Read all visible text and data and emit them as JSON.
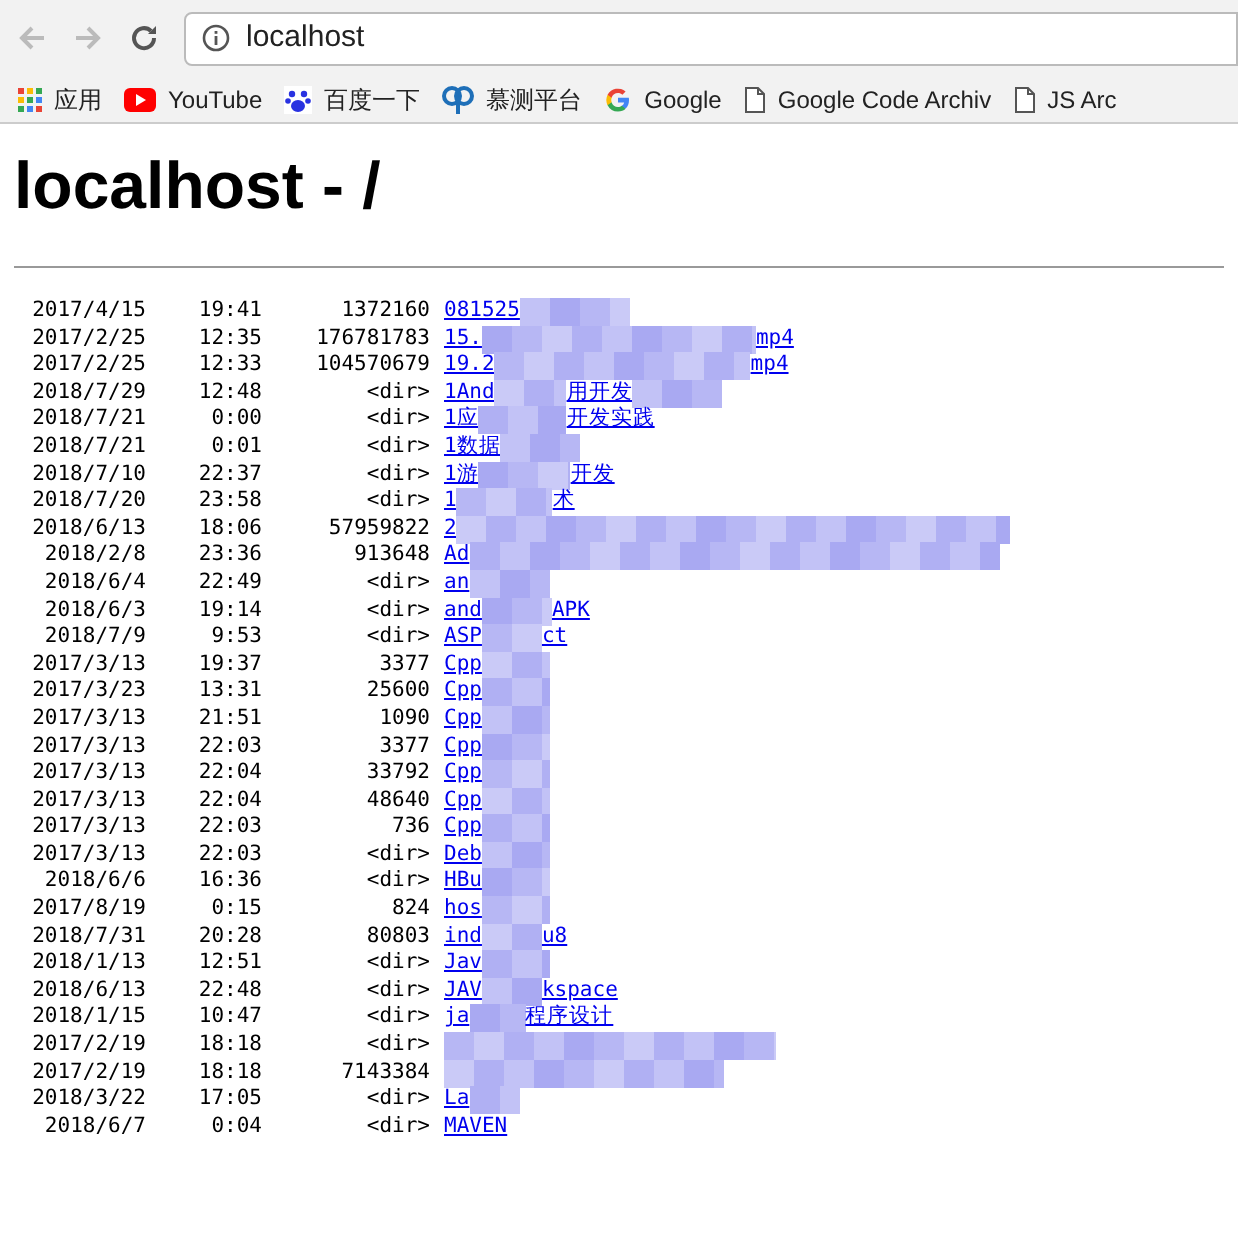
{
  "browser": {
    "address": "localhost",
    "bookmarks": [
      {
        "kind": "apps",
        "label": "应用"
      },
      {
        "kind": "youtube",
        "label": "YouTube"
      },
      {
        "kind": "baidu",
        "label": "百度一下"
      },
      {
        "kind": "muce",
        "label": "慕测平台"
      },
      {
        "kind": "google",
        "label": "Google"
      },
      {
        "kind": "page",
        "label": "Google Code Archiv"
      },
      {
        "kind": "page",
        "label": "JS Arc"
      }
    ]
  },
  "heading": "localhost - /",
  "listing": [
    {
      "date": "2017/4/15",
      "time": "19:41",
      "size": "1372160",
      "link": [
        "081525"
      ]
    },
    {
      "date": "2017/2/25",
      "time": "12:35",
      "size": "176781783",
      "link": [
        "15.",
        "mp4"
      ]
    },
    {
      "date": "2017/2/25",
      "time": "12:33",
      "size": "104570679",
      "link": [
        "19.2",
        "mp4"
      ]
    },
    {
      "date": "2018/7/29",
      "time": "12:48",
      "size": "<dir>",
      "link": [
        "1And",
        "用开发"
      ]
    },
    {
      "date": "2018/7/21",
      "time": "0:00",
      "size": "<dir>",
      "link": [
        "1应",
        "开发实践"
      ]
    },
    {
      "date": "2018/7/21",
      "time": "0:01",
      "size": "<dir>",
      "link": [
        "1数据"
      ]
    },
    {
      "date": "2018/7/10",
      "time": "22:37",
      "size": "<dir>",
      "link": [
        "1游",
        "开发"
      ]
    },
    {
      "date": "2018/7/20",
      "time": "23:58",
      "size": "<dir>",
      "link": [
        "1",
        "术"
      ]
    },
    {
      "date": "2018/6/13",
      "time": "18:06",
      "size": "57959822",
      "link": [
        "2"
      ]
    },
    {
      "date": "2018/2/8",
      "time": "23:36",
      "size": "913648",
      "link": [
        "Ad"
      ]
    },
    {
      "date": "2018/6/4",
      "time": "22:49",
      "size": "<dir>",
      "link": [
        "an"
      ]
    },
    {
      "date": "2018/6/3",
      "time": "19:14",
      "size": "<dir>",
      "link": [
        "and",
        "APK"
      ]
    },
    {
      "date": "2018/7/9",
      "time": "9:53",
      "size": "<dir>",
      "link": [
        "ASP",
        "ct"
      ]
    },
    {
      "date": "2017/3/13",
      "time": "19:37",
      "size": "3377",
      "link": [
        "Cpp"
      ]
    },
    {
      "date": "2017/3/23",
      "time": "13:31",
      "size": "25600",
      "link": [
        "Cpp"
      ]
    },
    {
      "date": "2017/3/13",
      "time": "21:51",
      "size": "1090",
      "link": [
        "Cpp"
      ]
    },
    {
      "date": "2017/3/13",
      "time": "22:03",
      "size": "3377",
      "link": [
        "Cpp"
      ]
    },
    {
      "date": "2017/3/13",
      "time": "22:04",
      "size": "33792",
      "link": [
        "Cpp"
      ]
    },
    {
      "date": "2017/3/13",
      "time": "22:04",
      "size": "48640",
      "link": [
        "Cpp"
      ]
    },
    {
      "date": "2017/3/13",
      "time": "22:03",
      "size": "736",
      "link": [
        "Cpp"
      ]
    },
    {
      "date": "2017/3/13",
      "time": "22:03",
      "size": "<dir>",
      "link": [
        "Deb"
      ]
    },
    {
      "date": "2018/6/6",
      "time": "16:36",
      "size": "<dir>",
      "link": [
        "HBu"
      ]
    },
    {
      "date": "2017/8/19",
      "time": "0:15",
      "size": "824",
      "link": [
        "hos"
      ]
    },
    {
      "date": "2018/7/31",
      "time": "20:28",
      "size": "80803",
      "link": [
        "ind",
        "u8"
      ]
    },
    {
      "date": "2018/1/13",
      "time": "12:51",
      "size": "<dir>",
      "link": [
        "Jav"
      ]
    },
    {
      "date": "2018/6/13",
      "time": "22:48",
      "size": "<dir>",
      "link": [
        "JAV",
        "kspace"
      ]
    },
    {
      "date": "2018/1/15",
      "time": "10:47",
      "size": "<dir>",
      "link": [
        "ja",
        "程序设计"
      ]
    },
    {
      "date": "2017/2/19",
      "time": "18:18",
      "size": "<dir>"
    },
    {
      "date": "2017/2/19",
      "time": "18:18",
      "size": "7143384"
    },
    {
      "date": "2018/3/22",
      "time": "17:05",
      "size": "<dir>",
      "link": [
        "La"
      ]
    },
    {
      "date": "2018/6/7",
      "time": "0:04",
      "size": "<dir>",
      "link": [
        "MAVEN"
      ]
    }
  ]
}
